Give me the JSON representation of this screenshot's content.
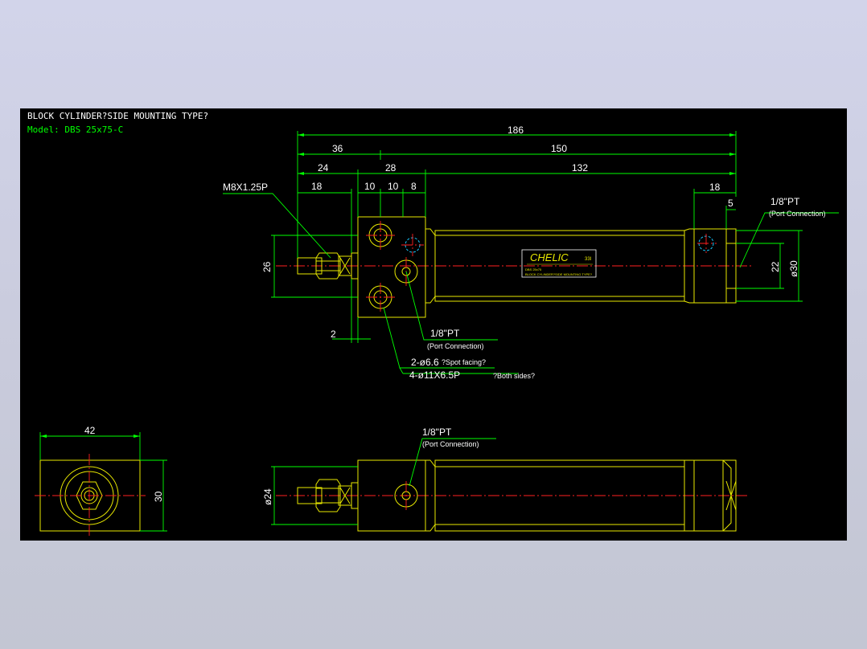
{
  "title": "BLOCK CYLINDER?SIDE MOUNTING TYPE?",
  "model": "Model: DBS 25x75-C",
  "dimensions": {
    "d186": "186",
    "d36": "36",
    "d150": "150",
    "d24": "24",
    "d28": "28",
    "d132": "132",
    "d18a": "18",
    "d10a": "10",
    "d10b": "10",
    "d8": "8",
    "d18b": "18",
    "d5": "5",
    "d26": "26",
    "d22": "22",
    "d30dia": "ø30",
    "d2": "2",
    "d42": "42",
    "d30": "30",
    "d24dia": "ø24"
  },
  "callouts": {
    "thread": "M8X1.25P",
    "port_rear": "1/8\"PT",
    "port_rear_note": "(Port Connection)",
    "port_front": "1/8\"PT",
    "port_front_note": "(Port Connection)",
    "holes_1": "2-ø6.6",
    "holes_1_note": "?Spot facing?",
    "holes_2": "4-ø11X6.5P",
    "holes_2_note": "?Both sides?",
    "port_bottom": "1/8\"PT",
    "port_bottom_note": "(Port Connection)"
  },
  "label_plate": {
    "brand": "CHELIC",
    "code": "33I",
    "line1": "DBS 25x75",
    "line2": "BLOCK CYLINDER?SIDE MOUNTING TYPE?"
  }
}
